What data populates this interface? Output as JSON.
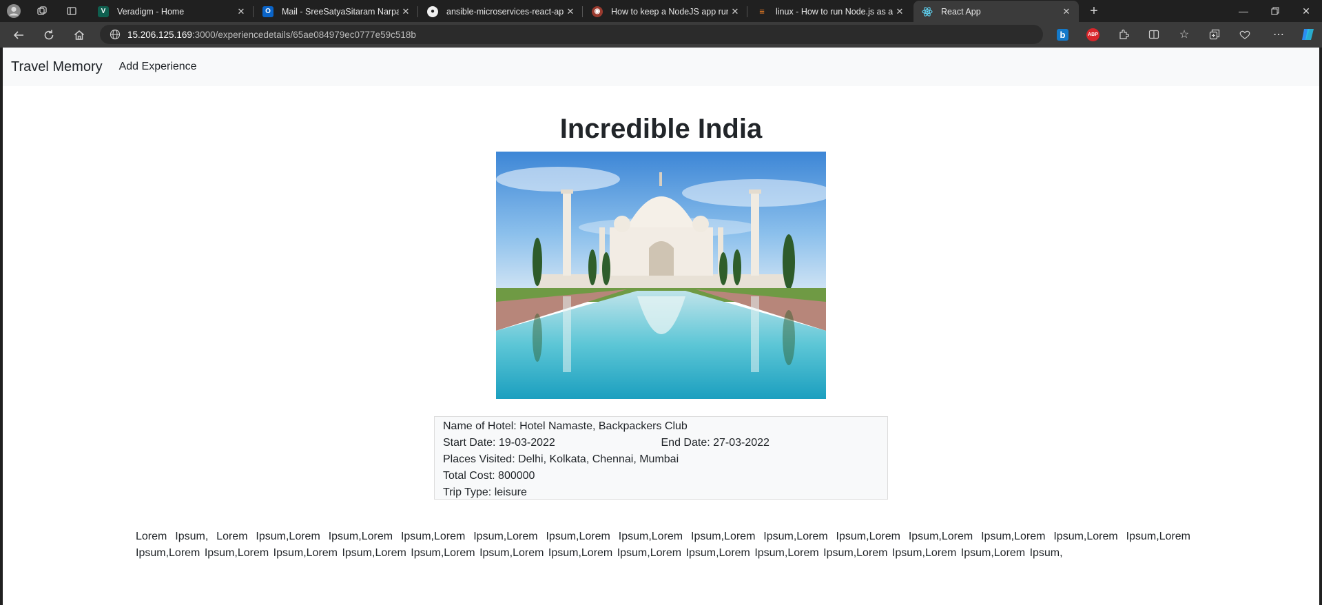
{
  "browser": {
    "tabs": [
      {
        "title": "Veradigm - Home",
        "favicon": "veradigm-favicon",
        "active": false
      },
      {
        "title": "Mail - SreeSatyaSitaram Narpare",
        "favicon": "outlook-favicon",
        "active": false
      },
      {
        "title": "ansible-microservices-react-app/",
        "favicon": "github-favicon",
        "active": false
      },
      {
        "title": "How to keep a NodeJS app runn",
        "favicon": "blog-favicon",
        "active": false
      },
      {
        "title": "linux - How to run Node.js as a b",
        "favicon": "stackoverflow-favicon",
        "active": false
      },
      {
        "title": "React App",
        "favicon": "react-favicon",
        "active": true
      }
    ],
    "address": {
      "host": "15.206.125.169",
      "path": ":3000/experiencedetails/65ae084979ec0777e59c518b"
    },
    "extensions": [
      "bing-icon",
      "adblock-icon",
      "extensions-icon",
      "split-screen-icon",
      "favorites-icon",
      "collections-icon",
      "performance-icon",
      "more-icon",
      "copilot-icon"
    ]
  },
  "navbar": {
    "brand": "Travel Memory",
    "links": [
      "Add Experience"
    ]
  },
  "experience": {
    "title": "Incredible India",
    "hotel_label": "Name of Hotel:",
    "hotel": "Hotel Namaste, Backpackers Club",
    "start_label": "Start Date:",
    "start_date": "19-03-2022",
    "end_label": "End Date:",
    "end_date": "27-03-2022",
    "places_label": "Places Visited:",
    "places": "Delhi, Kolkata, Chennai, Mumbai",
    "cost_label": "Total Cost:",
    "cost": "800000",
    "trip_type_label": "Trip Type:",
    "trip_type": "leisure",
    "description": "Lorem Ipsum, Lorem Ipsum,Lorem Ipsum,Lorem Ipsum,Lorem Ipsum,Lorem Ipsum,Lorem Ipsum,Lorem Ipsum,Lorem Ipsum,Lorem Ipsum,Lorem Ipsum,Lorem Ipsum,Lorem Ipsum,Lorem Ipsum,Lorem Ipsum,Lorem Ipsum,Lorem Ipsum,Lorem Ipsum,Lorem Ipsum,Lorem Ipsum,Lorem Ipsum,Lorem Ipsum,Lorem Ipsum,Lorem Ipsum,Lorem Ipsum,Lorem Ipsum,Lorem Ipsum,Lorem Ipsum,"
  },
  "colors": {
    "chrome_bg": "#202020",
    "toolbar_bg": "#3b3b3b",
    "navbar_bg": "#f8f9fa",
    "text": "#212529"
  }
}
